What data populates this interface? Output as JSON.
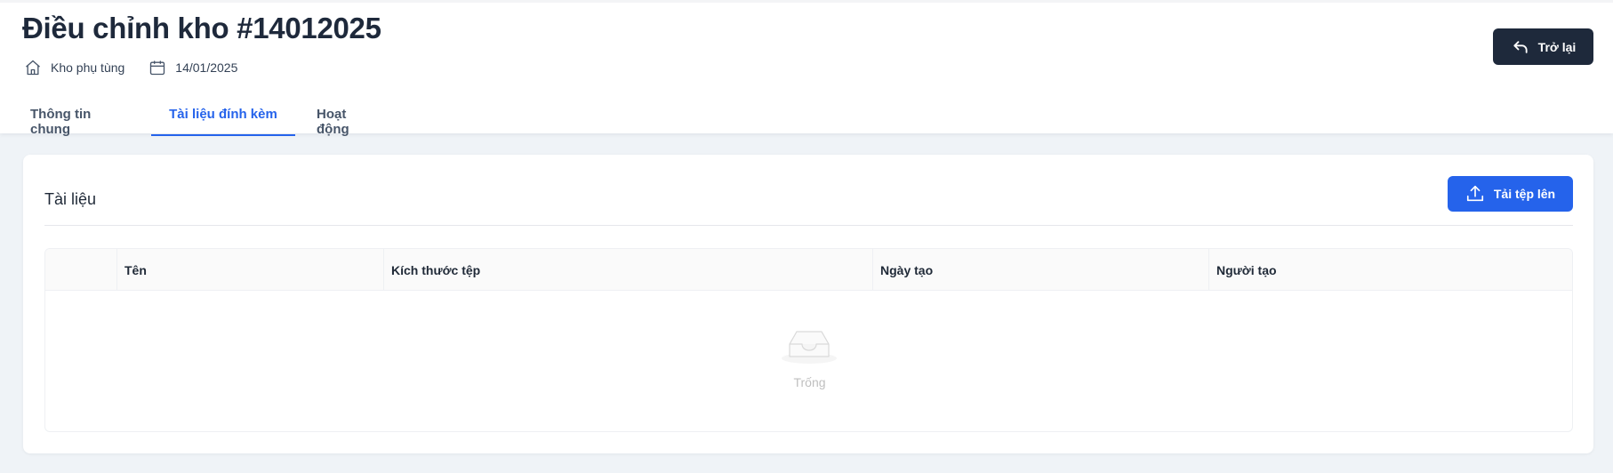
{
  "page": {
    "title": "Điều chỉnh kho #14012025",
    "warehouse": "Kho phụ tùng",
    "warehouse_icon": "home-icon",
    "date": "14/01/2025",
    "date_icon": "calendar-icon"
  },
  "actions": {
    "back_label": "Trở lại",
    "back_icon": "undo-arrow-icon"
  },
  "tabs": [
    {
      "label": "Thông tin chung",
      "active": false
    },
    {
      "label": "Tài liệu đính kèm",
      "active": true
    },
    {
      "label": "Hoạt động",
      "active": false
    }
  ],
  "documents": {
    "title": "Tài liệu",
    "upload_label": "Tải tệp lên",
    "upload_icon": "upload-icon",
    "columns": [
      "",
      "Tên",
      "Kích thước tệp",
      "Ngày tạo",
      "Người tạo"
    ],
    "rows": [],
    "empty_text": "Trống",
    "empty_icon": "inbox-icon"
  },
  "colors": {
    "accent": "#2563eb",
    "dark": "#1e293b",
    "background": "#eff3f7"
  }
}
